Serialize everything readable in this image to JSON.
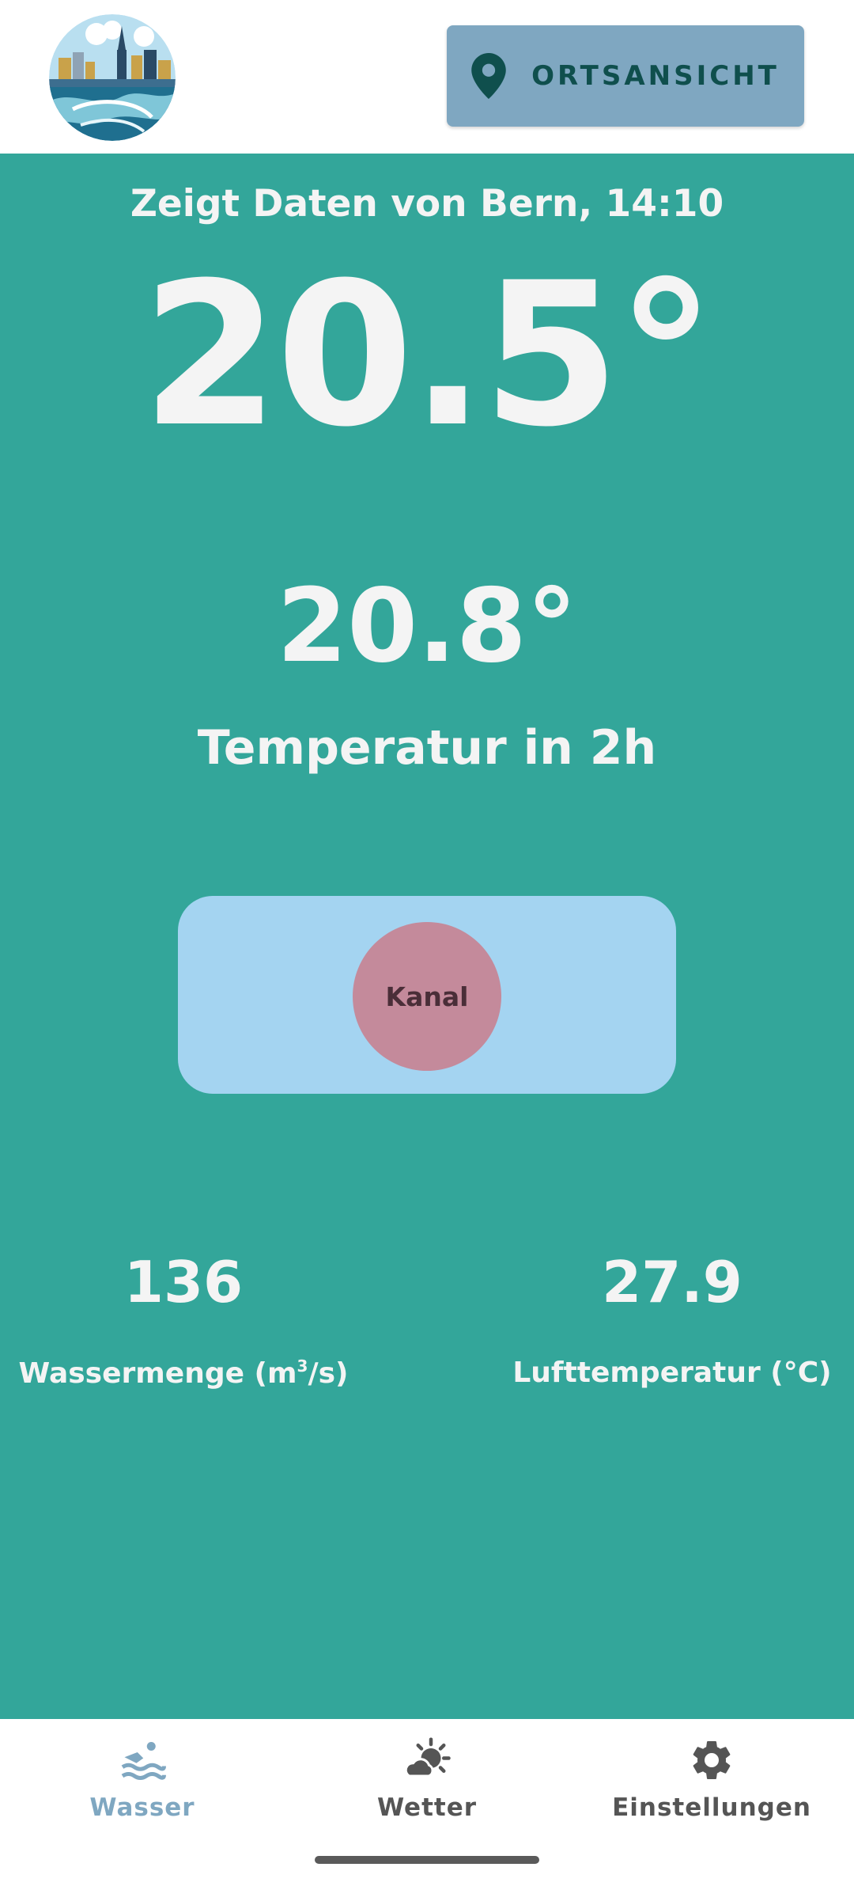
{
  "header": {
    "logo_icon": "city-river-logo-icon",
    "location_button": {
      "icon": "location-pin-icon",
      "label": "ORTSANSICHT"
    }
  },
  "main": {
    "subtitle": "Zeigt Daten von Bern, 14:10",
    "current_temperature": "20.5°",
    "forecast_temperature": "20.8°",
    "forecast_label": "Temperatur in 2h",
    "toggle": {
      "label": "Kanal"
    },
    "stats": [
      {
        "value": "136",
        "label_main": "Wassermenge (m",
        "label_sup": "3",
        "label_end": "/s)"
      },
      {
        "value": "27.9",
        "label_main": "Lufttemperatur (°C)"
      }
    ]
  },
  "bottom_nav": {
    "items": [
      {
        "label": "Wasser",
        "icon": "swimmer-icon",
        "active": true
      },
      {
        "label": "Wetter",
        "icon": "sun-cloud-icon",
        "active": false
      },
      {
        "label": "Einstellungen",
        "icon": "gear-icon",
        "active": false
      }
    ]
  },
  "colors": {
    "background": "#33a69a",
    "header": "#ffffff",
    "accent": "#7fa7c1",
    "toggle_bg": "#a4d4f1",
    "toggle_knob": "#c48a9b"
  }
}
